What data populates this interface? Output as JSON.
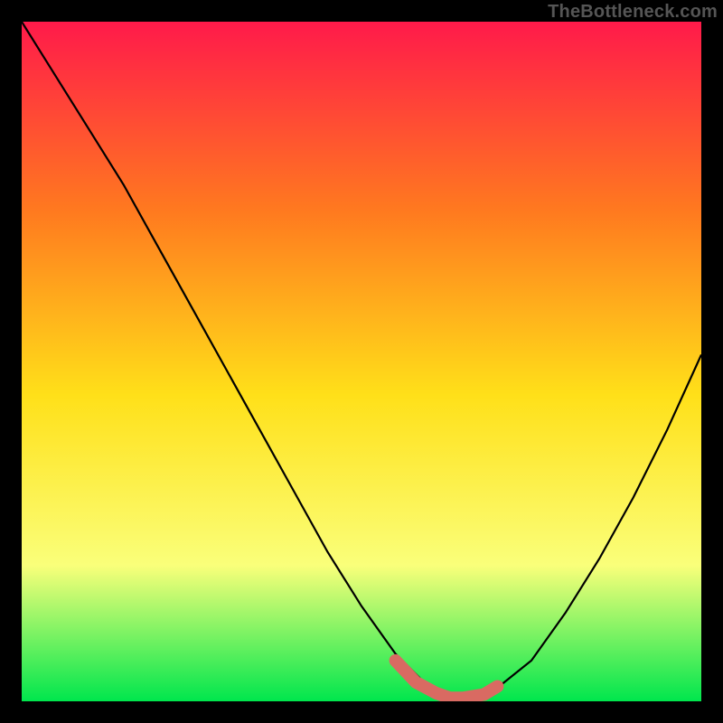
{
  "watermark": "TheBottleneck.com",
  "chart_data": {
    "type": "line",
    "title": "",
    "xlabel": "",
    "ylabel": "",
    "xlim": [
      0,
      100
    ],
    "ylim": [
      0,
      100
    ],
    "series": [
      {
        "name": "curve",
        "x": [
          0,
          5,
          10,
          15,
          20,
          25,
          30,
          35,
          40,
          45,
          50,
          55,
          60,
          63,
          65,
          68,
          70,
          75,
          80,
          85,
          90,
          95,
          100
        ],
        "values": [
          100,
          92,
          84,
          76,
          67,
          58,
          49,
          40,
          31,
          22,
          14,
          7,
          2,
          0.5,
          0.2,
          0.5,
          2,
          6,
          13,
          21,
          30,
          40,
          51
        ]
      }
    ],
    "highlight": {
      "name": "flat-region",
      "color": "#d96a62",
      "x": [
        55,
        58,
        61,
        63,
        65,
        68,
        70
      ],
      "values": [
        6,
        2.8,
        1.2,
        0.5,
        0.5,
        1.0,
        2.2
      ]
    },
    "colors": {
      "gradient_top": "#ff1a4a",
      "gradient_mid_upper": "#ff7a1f",
      "gradient_mid": "#ffe019",
      "gradient_mid_lower": "#faff7a",
      "gradient_bottom": "#00e64d",
      "curve": "#000000",
      "highlight": "#d96a62",
      "frame": "#000000"
    }
  }
}
